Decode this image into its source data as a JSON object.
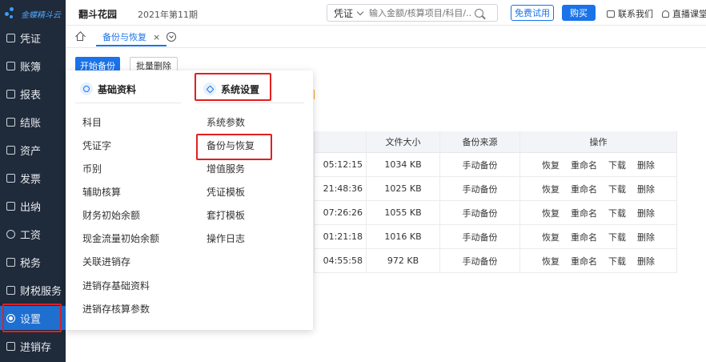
{
  "app": {
    "logo_text": "金蝶精斗云",
    "company": "翻斗花园",
    "period": "2021年第11期"
  },
  "sidebar": {
    "items": [
      {
        "label": "凭证"
      },
      {
        "label": "账簿"
      },
      {
        "label": "报表"
      },
      {
        "label": "结账"
      },
      {
        "label": "资产"
      },
      {
        "label": "发票"
      },
      {
        "label": "出纳"
      },
      {
        "label": "工资"
      },
      {
        "label": "税务"
      },
      {
        "label": "财税服务"
      },
      {
        "label": "设置",
        "active": true
      },
      {
        "label": "进销存"
      }
    ]
  },
  "header": {
    "search_type": "凭证",
    "search_placeholder": "输入金额/核算项目/科目/...",
    "trial_label": "免费试用",
    "buy_label": "购买",
    "contact_label": "联系我们",
    "live_label": "直播课堂"
  },
  "tabs": [
    {
      "label": "备份与恢复",
      "close": "×"
    }
  ],
  "toolbar": {
    "start_backup": "开始备份",
    "batch_delete": "批量删除"
  },
  "table": {
    "columns": [
      "",
      "文件大小",
      "备份来源",
      "操作"
    ],
    "rows": [
      {
        "time": "05:12:15",
        "size": "1034 KB",
        "source": "手动备份"
      },
      {
        "time": "21:48:36",
        "size": "1025 KB",
        "source": "手动备份"
      },
      {
        "time": "07:26:26",
        "size": "1055 KB",
        "source": "手动备份"
      },
      {
        "time": "01:21:18",
        "size": "1016 KB",
        "source": "手动备份"
      },
      {
        "time": "04:55:58",
        "size": "972 KB",
        "source": "手动备份"
      }
    ],
    "actions": {
      "restore": "恢复",
      "rename": "重命名",
      "download": "下载",
      "delete": "删除"
    }
  },
  "menu": {
    "basic": {
      "title": "基础资料",
      "items": [
        "科目",
        "凭证字",
        "币别",
        "辅助核算",
        "财务初始余额",
        "现金流量初始余额",
        "关联进销存",
        "进销存基础资料",
        "进销存核算参数"
      ]
    },
    "system": {
      "title": "系统设置",
      "items": [
        "系统参数",
        "备份与恢复",
        "增值服务",
        "凭证模板",
        "套打模板",
        "操作日志"
      ]
    }
  },
  "colors": {
    "sidebar_bg": "#1f2a3a",
    "accent": "#1a73e8",
    "highlight": "#e02020"
  }
}
